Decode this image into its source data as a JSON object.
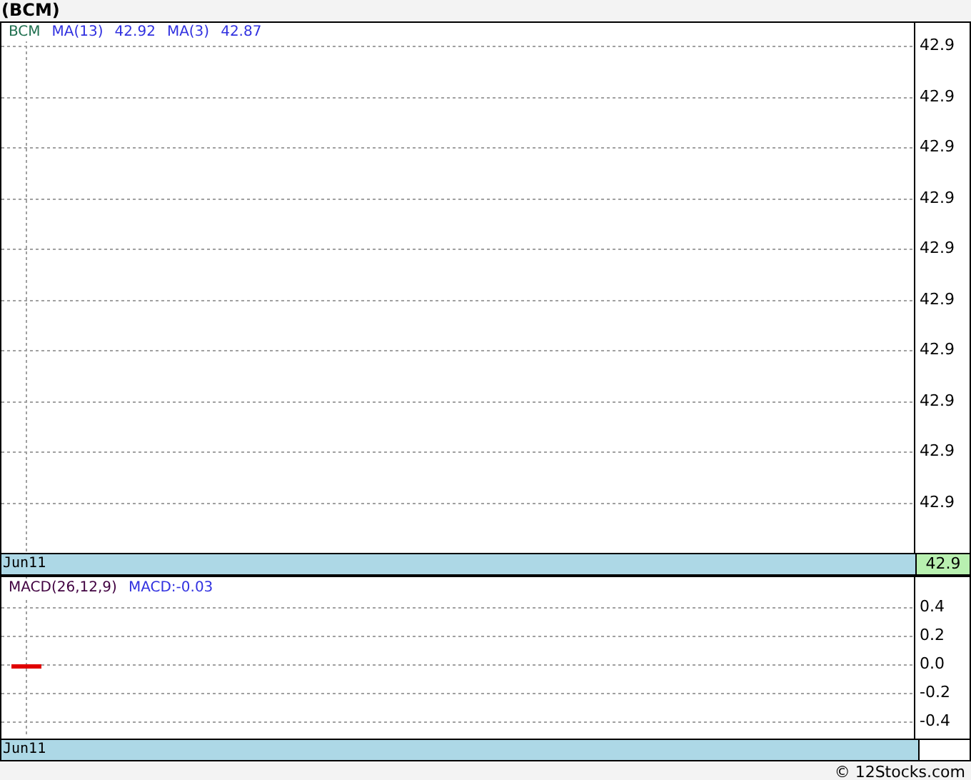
{
  "title": "(BCM)",
  "price_panel": {
    "legend": [
      {
        "text": "BCM",
        "kind": "symbol"
      },
      {
        "text": "MA(13)",
        "kind": "series"
      },
      {
        "text": "42.92",
        "kind": "series"
      },
      {
        "text": "MA(3)",
        "kind": "series"
      },
      {
        "text": "42.87",
        "kind": "series"
      }
    ],
    "axis_labels": [
      "42.9",
      "42.9",
      "42.9",
      "42.9",
      "42.9",
      "42.9",
      "42.9",
      "42.9",
      "42.9",
      "42.9"
    ],
    "date_label": "Jun11",
    "last_price": "42.9"
  },
  "macd_panel": {
    "legend": [
      {
        "text": "MACD(26,12,9)",
        "kind": "symbol"
      },
      {
        "text": "MACD:-0.03",
        "kind": "series"
      }
    ],
    "chart_data": {
      "type": "bar",
      "categories": [
        "Jun11"
      ],
      "series": [
        {
          "color": "#e00000",
          "values": [
            -0.03
          ]
        }
      ],
      "ylim": [
        -0.52,
        0.61
      ],
      "grid": true,
      "yticks": [
        {
          "value": 0.4,
          "label": "0.4"
        },
        {
          "value": 0.2,
          "label": "0.2"
        },
        {
          "value": 0,
          "label": "0.0"
        },
        {
          "value": -0.2,
          "label": "-0.2"
        },
        {
          "value": -0.4,
          "label": "-0.4"
        }
      ]
    },
    "kind": "macd"
  },
  "footer": "© 12Stocks.com"
}
